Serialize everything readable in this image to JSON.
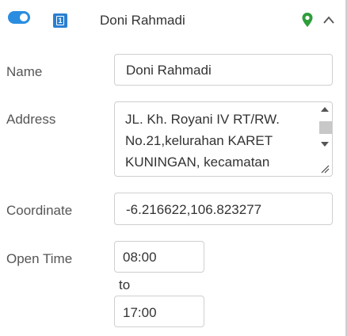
{
  "header": {
    "toggle_state": "on",
    "badge": "1",
    "title": "Doni Rahmadi",
    "icons": [
      "toggle-on-icon",
      "map-pin-icon",
      "chevron-up-icon"
    ],
    "accent_color": "#2a8de0",
    "pin_color": "#2e9e3a"
  },
  "form": {
    "name": {
      "label": "Name",
      "value": "Doni Rahmadi"
    },
    "address": {
      "label": "Address",
      "value": "JL. Kh. Royani IV RT/RW. No.21,kelurahan KARET KUNINGAN, kecamatan"
    },
    "coordinate": {
      "label": "Coordinate",
      "value": "-6.216622,106.823277"
    },
    "open_time": {
      "label": "Open Time",
      "from": "08:00",
      "separator": "to",
      "to": "17:00"
    }
  }
}
